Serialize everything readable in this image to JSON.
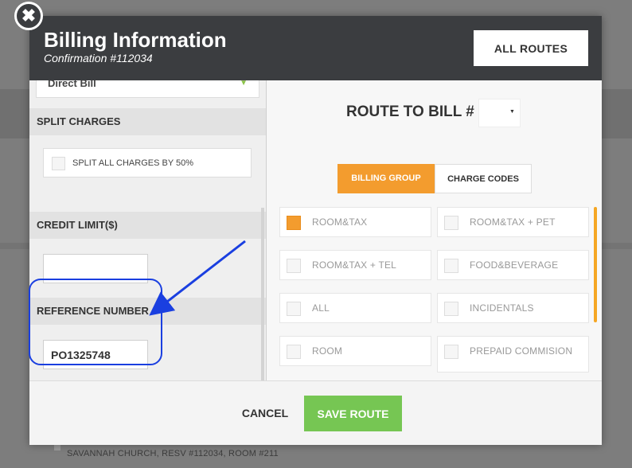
{
  "background": {
    "footer_text": "SAVANNAH CHURCH, RESV #112034, ROOM #211"
  },
  "modal": {
    "title": "Billing Information",
    "subtitle": "Confirmation #112034",
    "all_routes_label": "ALL ROUTES",
    "close_glyph": "✖"
  },
  "left": {
    "payment_type": "Direct Bill",
    "split_charges_head": "SPLIT CHARGES",
    "split_option_label": "SPLIT ALL CHARGES BY 50%",
    "credit_limit_head": "CREDIT LIMIT($)",
    "credit_limit_value": "",
    "reference_head": "REFERENCE NUMBER",
    "reference_value": "PO1325748"
  },
  "right": {
    "route_label": "ROUTE TO BILL #",
    "tabs": [
      {
        "label": "BILLING GROUP",
        "active": true
      },
      {
        "label": "CHARGE CODES",
        "active": false
      }
    ],
    "options": [
      {
        "label": "ROOM&TAX",
        "checked": true
      },
      {
        "label": "ROOM&TAX + PET",
        "checked": false
      },
      {
        "label": "ROOM&TAX + TEL",
        "checked": false
      },
      {
        "label": "FOOD&BEVERAGE",
        "checked": false
      },
      {
        "label": "ALL",
        "checked": false
      },
      {
        "label": "INCIDENTALS",
        "checked": false
      },
      {
        "label": "ROOM",
        "checked": false
      },
      {
        "label": "PREPAID COMMISION",
        "checked": false
      }
    ]
  },
  "footer": {
    "cancel_label": "CANCEL",
    "save_label": "SAVE ROUTE"
  },
  "colors": {
    "header": "#3b3d40",
    "accent_orange": "#f39c2e",
    "save_green": "#76c653",
    "annotation_blue": "#1a3fe0"
  },
  "icons": [
    "close-icon",
    "chevron-down-icon",
    "checkbox-icon",
    "arrow-annotation"
  ]
}
